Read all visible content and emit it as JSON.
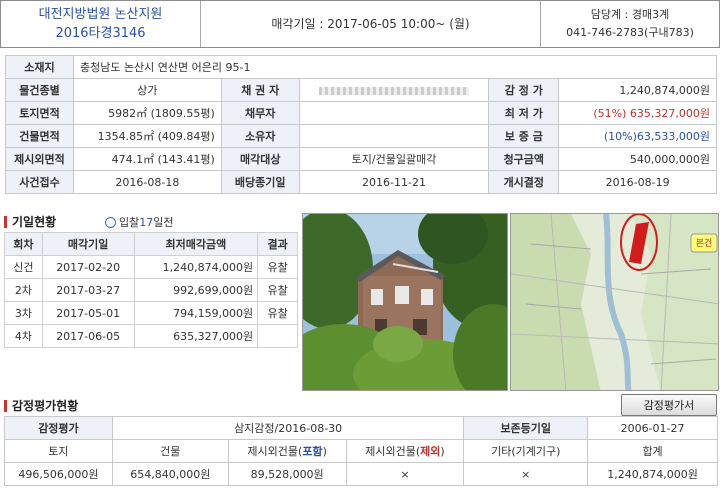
{
  "header": {
    "court": "대전지방법원 논산지원",
    "case_no": "2016타경3146",
    "sale_date_label": "매각기일 : 2017-06-05 10:00~ (월)",
    "dept": "담당계 : 경매3계",
    "phone": "041-746-2783(구내783)"
  },
  "info": {
    "location_label": "소재지",
    "location_value": "충청남도 논산시 연산면 어은리 95-1",
    "type_label": "물건종별",
    "type_value": "상가",
    "creditor_label": "채 권 자",
    "appraisal_label": "감 정 가",
    "appraisal_value": "1,240,874,000원",
    "land_label": "토지면적",
    "land_value": "5982㎡ (1809.55평)",
    "debtor_label": "채무자",
    "minprice_label": "최 저 가",
    "minprice_pct": "(51%)",
    "minprice_value": "635,327,000원",
    "bldg_label": "건물면적",
    "bldg_value": "1354.85㎡ (409.84평)",
    "owner_label": "소유자",
    "deposit_label": "보 증 금",
    "deposit_value": "(10%)63,533,000원",
    "excl_label": "제시외면적",
    "excl_value": "474.1㎡ (143.41평)",
    "target_label": "매각대상",
    "target_value": "토지/건물일괄매각",
    "claim_label": "청구금액",
    "claim_value": "540,000,000원",
    "receipt_label": "사건접수",
    "receipt_value": "2016-08-18",
    "dividend_label": "배당종기일",
    "dividend_value": "2016-11-21",
    "start_label": "개시결정",
    "start_value": "2016-08-19"
  },
  "history": {
    "title": "기일현황",
    "sub_prefix": "입찰",
    "sub_days": "17",
    "sub_suffix": "일전",
    "headers": [
      "회차",
      "매각기일",
      "최저매각금액",
      "결과"
    ],
    "rows": [
      {
        "round": "신건",
        "date": "2017-02-20",
        "price": "1,240,874,000원",
        "result": "유찰"
      },
      {
        "round": "2차",
        "date": "2017-03-27",
        "price": "992,699,000원",
        "result": "유찰"
      },
      {
        "round": "3차",
        "date": "2017-05-01",
        "price": "794,159,000원",
        "result": "유찰"
      },
      {
        "round": "4차",
        "date": "2017-06-05",
        "price": "635,327,000원",
        "result": ""
      }
    ]
  },
  "map": {
    "marker_label": "본건"
  },
  "appraisal": {
    "title": "감정평가현황",
    "button": "감정평가서",
    "label": "감정평가",
    "firm": "삼지감정/2016-08-30",
    "base_label": "보존등기일",
    "base_value": "2006-01-27",
    "cols": {
      "land": "토지",
      "bldg": "건물",
      "incl_pre": "제시외건물(",
      "incl_word": "포함",
      "incl_post": ")",
      "excl_pre": "제시외건물(",
      "excl_word": "제외",
      "excl_post": ")",
      "etc": "기타(기계기구)",
      "total": "합계"
    },
    "vals": {
      "land": "496,506,000원",
      "bldg": "654,840,000원",
      "incl": "89,528,000원",
      "excl": "×",
      "etc": "×",
      "total": "1,240,874,000원"
    }
  },
  "colors": {
    "accent_blue": "#2b4ea8",
    "accent_red": "#c0302c",
    "label_bg": "#eef1f7"
  }
}
